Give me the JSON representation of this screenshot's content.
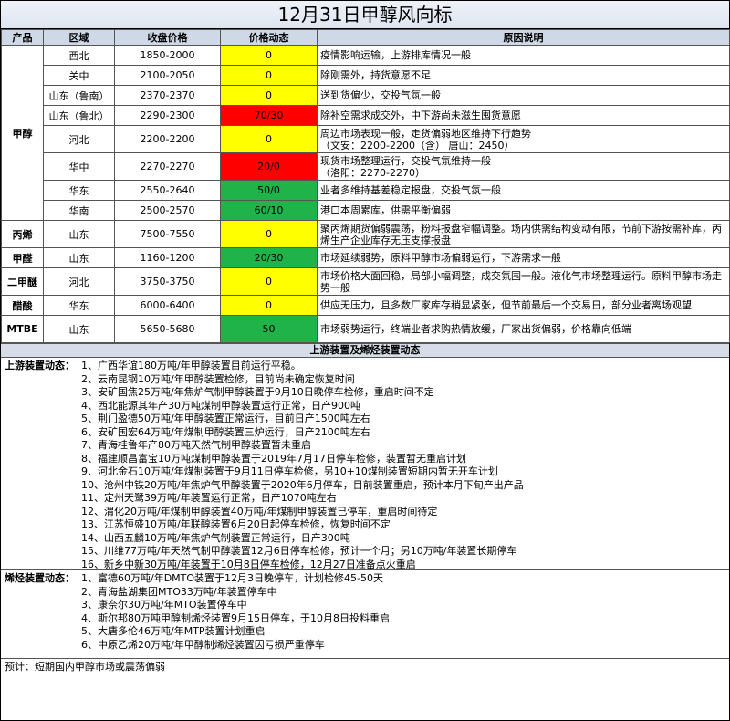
{
  "title": "12月31日甲醇风向标",
  "headers": [
    "产品",
    "区域",
    "收盘价格",
    "价格动态",
    "原因说明"
  ],
  "rows": [
    {
      "product": "甲醇",
      "region": "西北",
      "price": "1850-2000",
      "dynamic": "0",
      "color": "yellow",
      "reason": "疫情影响运输，上游排库情况一般"
    },
    {
      "product": "",
      "region": "关中",
      "price": "2100-2050",
      "dynamic": "0",
      "color": "yellow",
      "reason": "除刚需外，持货意愿不足"
    },
    {
      "product": "",
      "region": "山东（鲁南）",
      "price": "2370-2370",
      "dynamic": "0",
      "color": "yellow",
      "reason": "送到货偏少，交投气氛一般"
    },
    {
      "product": "",
      "region": "山东（鲁北）",
      "price": "2290-2300",
      "dynamic": "70/30",
      "color": "red",
      "reason": "除补空需求成交外，中下游尚未滋生囤货意愿"
    },
    {
      "product": "",
      "region": "河北",
      "price": "2200-2200",
      "dynamic": "0",
      "color": "yellow",
      "reason": "周边市场表现一般，走货偏弱地区维持下行趋势\n（文安：2200-2200（含） 唐山：2450）"
    },
    {
      "product": "",
      "region": "华中",
      "price": "2270-2270",
      "dynamic": "20/0",
      "color": "red",
      "reason": "现货市场整理运行，交投气氛维持一般\n（洛阳：2270-2270）"
    },
    {
      "product": "",
      "region": "华东",
      "price": "2550-2640",
      "dynamic": "50/0",
      "color": "green",
      "reason": "业者多维持基差稳定报盘，交投气氛一般"
    },
    {
      "product": "",
      "region": "华南",
      "price": "2500-2570",
      "dynamic": "60/10",
      "color": "green",
      "reason": "港口本周累库，供需平衡偏弱"
    },
    {
      "product": "丙烯",
      "region": "山东",
      "price": "7500-7550",
      "dynamic": "0",
      "color": "yellow",
      "reason": "聚丙烯期货偏弱震荡，粉料报盘窄幅调整。场内供需结构变动有限，节前下游按需补库，丙烯生产企业库存无压支撑报盘"
    },
    {
      "product": "甲醛",
      "region": "山东",
      "price": "1160-1200",
      "dynamic": "20/30",
      "color": "green",
      "reason": "市场延续弱势，原料甲醇市场偏弱运行，下游需求一般"
    },
    {
      "product": "二甲醚",
      "region": "河北",
      "price": "3750-3750",
      "dynamic": "0",
      "color": "yellow",
      "reason": "市场价格大面回稳，局部小幅调整，成交氛围一般。液化气市场整理运行。原料甲醇市场走势一般"
    },
    {
      "product": "醋酸",
      "region": "华东",
      "price": "6000-6400",
      "dynamic": "0",
      "color": "yellow",
      "reason": "供应无压力，且多数厂家库存稍显紧张，但节前最后一个交易日，部分业者离场观望"
    },
    {
      "product": "MTBE",
      "region": "山东",
      "price": "5650-5680",
      "dynamic": "50",
      "color": "green",
      "reason": "市场弱势运行，终端业者求购热情放缓，厂家出货偏弱，价格靠向低端"
    }
  ],
  "section_title": "上游装置及烯烃装置动态",
  "upstream": {
    "label": "上游装置动态：",
    "items": [
      "1、广西华谊180万吨/年甲醇装置目前运行平稳。",
      "2、云南昆钢10万吨/年甲醇装置检修，目前尚未确定恢复时间",
      "3、安矿国焦25万吨/年焦炉气制甲醇装置于9月10日晚停车检修，重启时间不定",
      "4、西北能源其年产30万吨煤制甲醇装置运行正常，日产900吨",
      "5、荆门盈德50万吨/年甲醇装置正常运行，目前日产1500吨左右",
      "6、安矿国宏64万吨/年煤制甲醇装置三炉运行，日产2100吨左右",
      "7、青海桂鲁年产80万吨天然气制甲醇装置暂未重启",
      "8、福建顺昌富宝10万吨煤制甲醇装置于2019年7月17日停车检修，装置暂无重启计划",
      "9、河北金石10万吨/年煤制装置于9月11日停车检修，另10+10煤制装置短期内暂无开车计划",
      "10、沧州中铁20万吨/年焦炉气甲醇装置于2020年6月停车，目前装置重启，预计本月下旬产出产品",
      "11、定州天鹭39万吨/年装置运行正常，日产1070吨左右",
      "12、渭化20万吨/年煤制甲醇装置40万吨/年煤制甲醇装置已停车，重启时间待定",
      "13、江苏恒盛10万吨/年联醇装置6月20日起停车检修，恢复时间不定",
      "14、山西五麟10万吨/年焦炉气制装置正常运行，日产300吨",
      "15、川维77万吨/年天然气制甲醇装置12月6日停车检修，预计一个月；另10万吨/年装置长期停车",
      "16、新乡中新30万吨/年装置于10月8日停车检修，12月27日准备点火重启"
    ]
  },
  "olefin": {
    "label": "烯烃装置动态：",
    "items": [
      "1、富德60万吨/年DMTO装置于12月3日晚停车，计划检修45-50天",
      "2、青海盐湖集团MTO33万吨/年装置停车中",
      "3、康奈尔30万吨/年MTO装置停车中",
      "4、斯尔邦80万吨甲醇制烯烃装置9月15日停车，于10月8日投料重启",
      "5、大唐多伦46万吨/年MTP装置计划重启",
      "6、中原乙烯20万吨/年甲醇制烯烃装置因亏损严重停车"
    ]
  },
  "forecast": "预计：短期国内甲醇市场或震荡偏弱"
}
